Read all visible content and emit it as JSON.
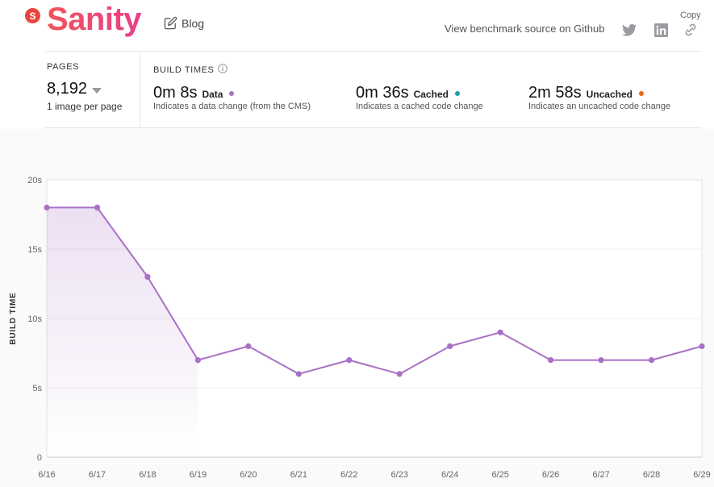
{
  "header": {
    "brand_badge": "S",
    "brand_name": "Sanity",
    "blog_label": "Blog",
    "github_label": "View benchmark source on Github",
    "copy_label": "Copy",
    "icons": [
      "edit-icon",
      "twitter-icon",
      "linkedin-icon",
      "link-icon"
    ]
  },
  "stats": {
    "pages_label": "PAGES",
    "pages_value": "8,192",
    "pages_sub": "1 image per page",
    "build_times_label": "BUILD TIMES",
    "metrics": [
      {
        "value": "0m 8s",
        "label": "Data",
        "desc": "Indicates a data change (from the CMS)",
        "color": "#a970c6"
      },
      {
        "value": "0m 36s",
        "label": "Cached",
        "desc": "Indicates a cached code change",
        "color": "#1aa3a3"
      },
      {
        "value": "2m 58s",
        "label": "Uncached",
        "desc": "Indicates an uncached code change",
        "color": "#e8651c"
      }
    ]
  },
  "chart_data": {
    "type": "line",
    "x": [
      "6/16",
      "6/17",
      "6/18",
      "6/19",
      "6/20",
      "6/21",
      "6/22",
      "6/23",
      "6/24",
      "6/25",
      "6/26",
      "6/27",
      "6/28",
      "6/29"
    ],
    "series": [
      {
        "values": [
          18,
          18,
          13,
          7,
          8,
          6,
          7,
          6,
          8,
          9,
          7,
          7,
          7,
          8
        ],
        "color": "#a970c6"
      }
    ],
    "ylabel": "BUILD TIME",
    "ylim": [
      0,
      20
    ],
    "yticks": [
      "0",
      "5s",
      "10s",
      "15s",
      "20s"
    ],
    "ytick_values": [
      0,
      5,
      10,
      15,
      20
    ],
    "grid": true
  }
}
